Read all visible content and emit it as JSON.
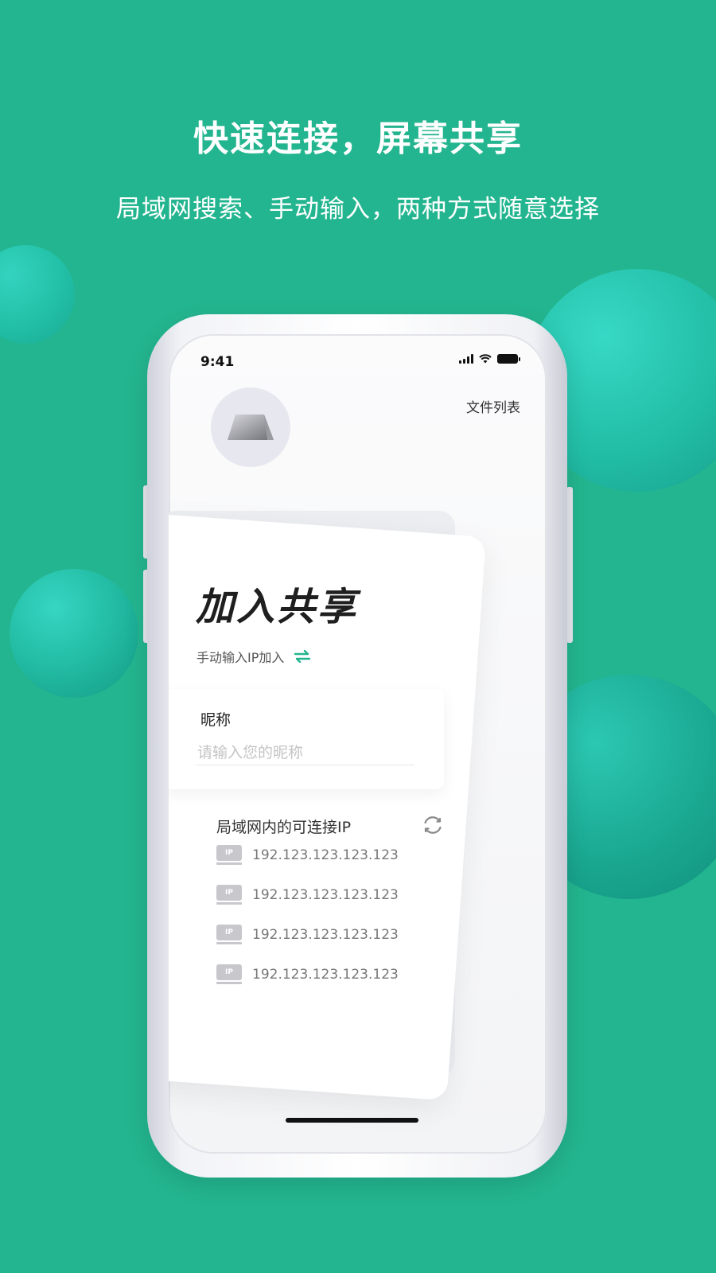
{
  "hero": {
    "title": "快速连接，屏幕共享",
    "subtitle": "局域网搜索、手动输入，两种方式随意选择"
  },
  "colors": {
    "background": "#23b58f",
    "accent": "#23b58f",
    "card": "#ffffff"
  },
  "status_bar": {
    "time": "9:41",
    "icons": [
      "signal-icon",
      "wifi-icon",
      "battery-icon"
    ]
  },
  "header": {
    "file_list_label": "文件列表"
  },
  "card": {
    "title": "加入共享",
    "manual_input_label": "手动输入IP加入",
    "switch_icon": "swap-arrows-icon"
  },
  "nickname": {
    "label": "昵称",
    "value": "",
    "placeholder": "请输入您的昵称"
  },
  "lan": {
    "title": "局域网内的可连接IP",
    "refresh_icon": "refresh-icon",
    "ip_badge": "IP",
    "items": [
      {
        "ip": "192.123.123.123.123"
      },
      {
        "ip": "192.123.123.123.123"
      },
      {
        "ip": "192.123.123.123.123"
      },
      {
        "ip": "192.123.123.123.123"
      }
    ]
  }
}
